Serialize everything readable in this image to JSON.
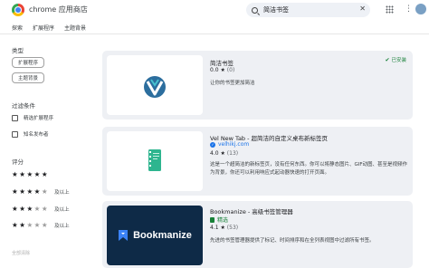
{
  "header": {
    "app_title": "chrome 应用商店",
    "search_value": "简洁书签",
    "clear_symbol": "✕",
    "more_symbol": "⋮"
  },
  "nav": {
    "tabs": [
      "探索",
      "扩展程序",
      "主题背景"
    ]
  },
  "sidebar": {
    "type_label": "类型",
    "type_chips": [
      "扩展程序",
      "主题背景"
    ],
    "filter_label": "过滤条件",
    "filters": [
      "精选扩展程序",
      "知名发布者"
    ],
    "rating_label": "评分",
    "ratings": [
      {
        "stars": 5,
        "suffix": ""
      },
      {
        "stars": 4,
        "suffix": "及以上"
      },
      {
        "stars": 3,
        "suffix": "及以上"
      },
      {
        "stars": 2,
        "suffix": "及以上"
      }
    ],
    "reset_label": "全部清除"
  },
  "results": [
    {
      "title": "简洁书签",
      "rating": "0.0",
      "count": "(0)",
      "installed_label": "已安装",
      "description": "让你的书签更加简洁",
      "thumb_style": "logo-v",
      "colors": {
        "primary": "#2c6e9e",
        "accent": "#46c1cf"
      }
    },
    {
      "title": "Vel New Tab - 超简洁的自定义桌布新标签页",
      "site": "velhikj.com",
      "rating": "4.0",
      "count": "(13)",
      "description": "这是一个超简洁的新标签页，没有任何东西。你可以将静态图片、GIF动图、甚至是视频作为背景，你还可以利用响应式起动器快速的打开页面。",
      "thumb_style": "green-book",
      "colors": {
        "primary": "#2eb58f"
      }
    },
    {
      "title": "Bookmanize - 高级书签管理器",
      "featured_label": "精选",
      "rating": "4.1",
      "count": "(53)",
      "description": "先进的书签管理器提供了标记、时间排序和在全列表视图中过滤所有书签。",
      "thumb_text": "Bookmanize",
      "colors": {
        "primary": "#0e2a47",
        "accent": "#3b82f6"
      }
    }
  ]
}
